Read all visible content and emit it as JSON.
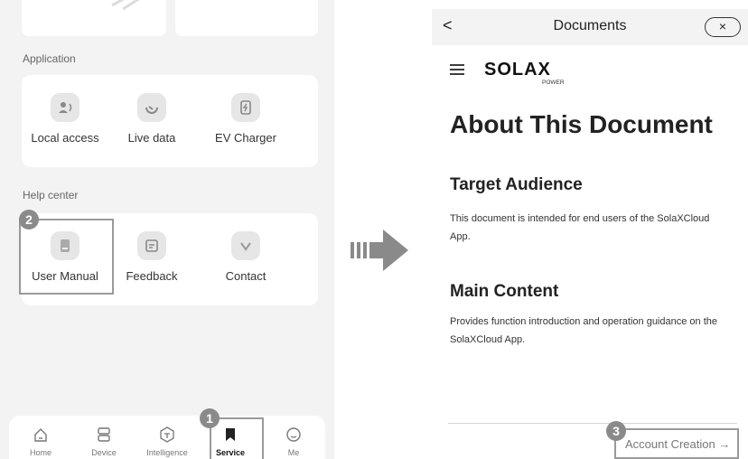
{
  "left": {
    "application": {
      "title": "Application",
      "items": [
        {
          "label": "Local access",
          "icon": "person-icon"
        },
        {
          "label": "Live data",
          "icon": "gauge-icon"
        },
        {
          "label": "EV Charger",
          "icon": "charger-icon"
        }
      ]
    },
    "help_center": {
      "title": "Help center",
      "items": [
        {
          "label": "User Manual",
          "icon": "manual-icon"
        },
        {
          "label": "Feedback",
          "icon": "feedback-icon"
        },
        {
          "label": "Contact",
          "icon": "contact-icon"
        }
      ]
    },
    "nav": [
      {
        "label": "Home",
        "icon": "home-icon"
      },
      {
        "label": "Device",
        "icon": "device-icon"
      },
      {
        "label": "Intelligence",
        "icon": "intelligence-icon"
      },
      {
        "label": "Service",
        "icon": "bookmark-icon",
        "active": true
      },
      {
        "label": "Me",
        "icon": "profile-icon"
      }
    ]
  },
  "callouts": {
    "one": "1",
    "two": "2",
    "three": "3"
  },
  "right": {
    "header": {
      "back": "<",
      "title": "Documents",
      "close": "×"
    },
    "logo": {
      "main": "SOLAX",
      "sub": "POWER"
    },
    "doc": {
      "heading": "About This Document",
      "sections": [
        {
          "title": "Target Audience",
          "body": "This document is intended for end users of the SolaXCloud App."
        },
        {
          "title": "Main Content",
          "body": "Provides function introduction and operation guidance on the SolaXCloud App."
        }
      ]
    },
    "next_link": "Account Creation →"
  },
  "colors": {
    "callout": "#8a8a8a",
    "background": "#f3f3f3"
  }
}
